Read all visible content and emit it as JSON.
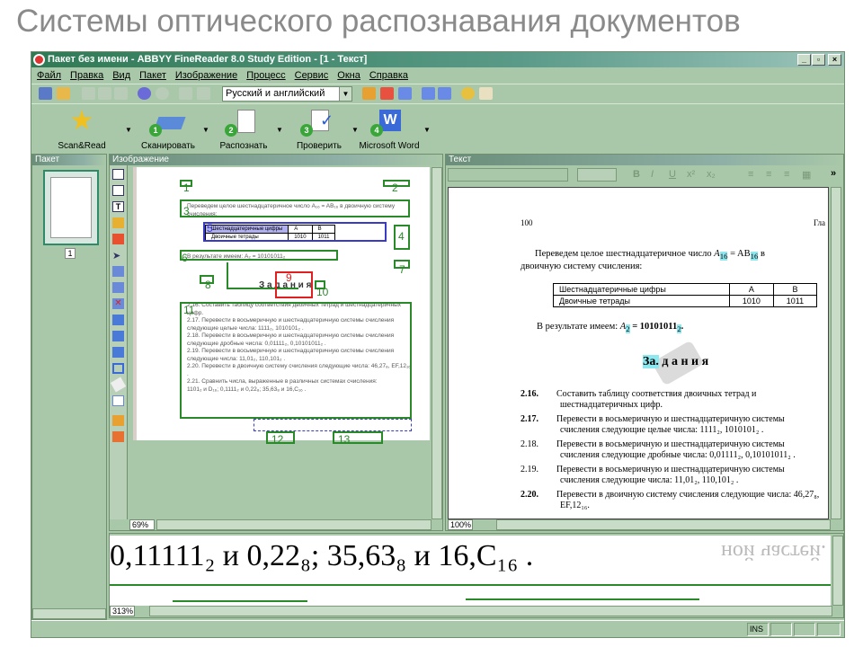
{
  "slide_title": "Системы оптического распознавания документов",
  "window": {
    "title": "Пакет без имени - ABBYY FineReader 8.0 Study Edition - [1 - Текст]",
    "controls": [
      "_",
      "▫",
      "×"
    ]
  },
  "menu": [
    "Файл",
    "Правка",
    "Вид",
    "Пакет",
    "Изображение",
    "Процесс",
    "Сервис",
    "Окна",
    "Справка"
  ],
  "toolbar": {
    "language": "Русский и английский"
  },
  "big_buttons": [
    {
      "label": "Scan&Read",
      "num": ""
    },
    {
      "label": "Сканировать",
      "num": "1"
    },
    {
      "label": "Распознать",
      "num": "2"
    },
    {
      "label": "Проверить",
      "num": "3"
    },
    {
      "label": "Microsoft Word",
      "num": "4"
    }
  ],
  "panes": {
    "packet": "Пакет",
    "image": "Изображение",
    "text": "Текст"
  },
  "packet": {
    "page_number": "1"
  },
  "image_pane": {
    "zoom": "69%",
    "block_numbers": [
      "1",
      "2",
      "3",
      "4",
      "5",
      "6",
      "7",
      "8",
      "9",
      "10",
      "11",
      "12",
      "13"
    ]
  },
  "text_pane": {
    "zoom": "100%",
    "format_buttons": [
      "B",
      "I",
      "U",
      "x²",
      "x₂"
    ],
    "more": "»",
    "page_num": "100",
    "header_right": "Гла",
    "para1": {
      "a": "Переведем целое шестнадцатеричное число ",
      "var": "A",
      "sub1": "16",
      "eq": " = AB",
      "sub2": "16",
      "b": " в двоичную систему счисления:"
    },
    "table": [
      [
        "Шестнадцатеричные цифры",
        "A",
        "B"
      ],
      [
        "Двоичные тетрады",
        "1010",
        "1011"
      ]
    ],
    "result": {
      "a": "В результате имеем: ",
      "var": "A",
      "sub": "2",
      "eq": " = 10101011",
      "sub2": "2",
      "end": "."
    },
    "heading": {
      "hl": "За.",
      "rest": " д а н и я"
    },
    "tasks": [
      {
        "n": "2.16.",
        "text": "Составить таблицу соответствия двоичных тетрад и шестнадцатеричных цифр."
      },
      {
        "n": "2.17.",
        "text": "Перевести в восьмеричную и шестнадцатеричную системы счисления следующие целые числа: 1111₂, 1010101₂ ."
      },
      {
        "n": "2.18.",
        "text": "Перевести в восьмеричную и шестнадцатеричную системы счисления следующие дробные числа: 0,01111₂, 0,10101011₂ ."
      },
      {
        "n": "2.19.",
        "text": "Перевести в восьмеричную и шестнадцатеричную системы счисления следующие числа: 11,01₂, 110,101₂ ."
      },
      {
        "n": "2.20.",
        "text": "Перевести в двоичную систему счисления следующие числа: 46,27₈, EF,12₁₆."
      }
    ]
  },
  "image_text": {
    "para1": "Переведем целое шестнадцатеричное число A₁₆ = AB₁₆ в двоичную систему счисления:",
    "table": [
      [
        "Шестнадцатеричные цифры",
        "A",
        "B"
      ],
      [
        "Двоичные тетрады",
        "1010",
        "1011"
      ]
    ],
    "result": "В результате имеем: A₂ = 10101011₂",
    "heading": "З а д а н и я",
    "tasks": [
      "2.16. Составить таблицу соответствия двоичных тетрад и шестнадцатеричных цифр.",
      "2.17. Перевести в восьмеричную и шестнадцатеричную системы счисления следующие целые числа: 1111₂, 1010101₂ .",
      "2.18. Перевести в восьмеричную и шестнадцатеричную системы счисления следующие дробные числа: 0,01111₂, 0,10101011₂ .",
      "2.19. Перевести в восьмеричную и шестнадцатеричную системы счисления следующие числа: 11,01₂, 110,101₂ .",
      "2.20. Перевести в двоичную систему счисления следующие числа: 46,27₈, EF,12₁₆ .",
      "2.21. Сравнить числа, выраженные в различных системах счисления:",
      "1101₂ и D₁₆;   0,1111₂ и 0,22₈;   35,63₈ и 16,C₁₆ ."
    ]
  },
  "zoom_pane": {
    "zoom": "313%",
    "text": "0,11111₂ и 0,22₈;   35,63₈ и 16,C₁₆ .",
    "ghost": "ной частей."
  },
  "status": {
    "ins": "INS"
  },
  "colors": {
    "window_bg": "#a9c8a9",
    "block_green": "#2a8a2a",
    "block_blue": "#3a3ac8",
    "block_red": "#e02020",
    "highlight": "#8ee8f0"
  }
}
